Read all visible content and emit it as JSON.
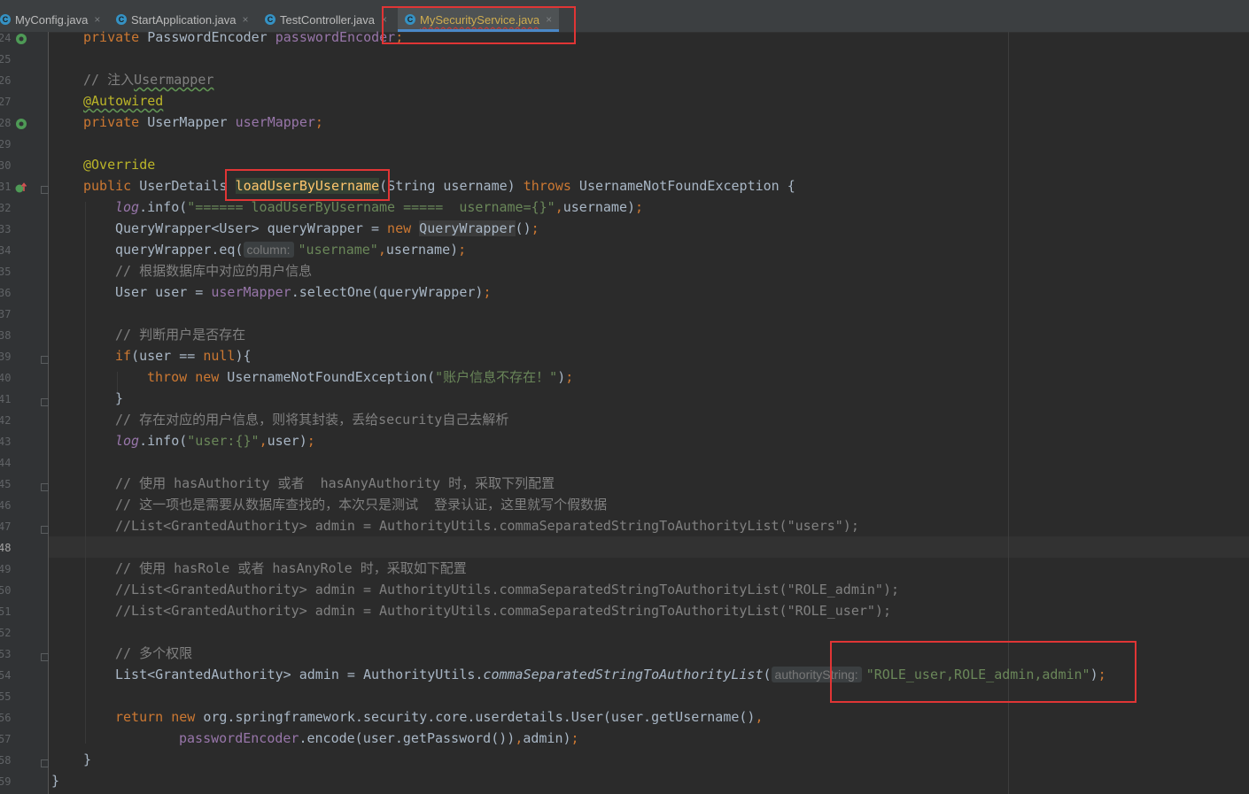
{
  "tabs": [
    {
      "label": "MyConfig.java",
      "icon": "class-icon",
      "close": "×"
    },
    {
      "label": "StartApplication.java",
      "icon": "class-icon",
      "close": "×"
    },
    {
      "label": "TestController.java",
      "icon": "class-icon",
      "close": "×"
    },
    {
      "label": "MySecurityService.java",
      "icon": "class-icon",
      "close": "×",
      "active": true
    }
  ],
  "tab_icon_glyph": "C",
  "gutter": {
    "line_numbers": [
      "24",
      "25",
      "26",
      "27",
      "28",
      "29",
      "30",
      "31",
      "32",
      "33",
      "34",
      "35",
      "36",
      "37",
      "38",
      "39",
      "40",
      "41",
      "42",
      "43",
      "44",
      "45",
      "46",
      "47",
      "48",
      "49",
      "50",
      "51",
      "52",
      "53",
      "54",
      "55",
      "56",
      "57",
      "58",
      "59"
    ],
    "current_line": "48",
    "icons": [
      "bean-icon",
      "bean-icon",
      "override-method-icon"
    ]
  },
  "code": {
    "field_pe_kw": "private",
    "field_pe_type": " PasswordEncoder ",
    "field_pe_name": "passwordEncoder",
    "field_pe_semi": ";",
    "comment_inject_prefix": "// 注入",
    "comment_inject_word": "Usermapper",
    "autowired": "@Autowired",
    "field_um_kw": "private",
    "field_um_type": " UserMapper ",
    "field_um_name": "userMapper",
    "field_um_semi": ";",
    "override": "@Override",
    "method_public": "public",
    "method_ret": " UserDetails ",
    "method_name": "loadUserByUsername",
    "method_params": "(String username) ",
    "method_throws": "throws",
    "method_exc": " UsernameNotFoundException {",
    "l32_log": "log",
    "l32_info": ".info(",
    "l32_str": "\"====== loadUserByUsername =====  username={}\"",
    "l32_comma": ",",
    "l32_rest": "username)",
    "l32_semi": ";",
    "l33_a": "QueryWrapper<User> queryWrapper = ",
    "l33_new": "new",
    "l33_sp": " ",
    "l33_cls": "QueryWrapper",
    "l33_b": "()",
    "l33_semi": ";",
    "l34_a": "queryWrapper.eq(",
    "l34_hint": "column:",
    "l34_str": "\"username\"",
    "l34_comma": ",",
    "l34_b": "username)",
    "l34_semi": ";",
    "l35_comment": "// 根据数据库中对应的用户信息",
    "l36_a": "User user = ",
    "l36_field": "userMapper",
    "l36_b": ".selectOne(queryWrapper)",
    "l36_semi": ";",
    "l38_comment": "// 判断用户是否存在",
    "l39_if": "if",
    "l39_a": "(user == ",
    "l39_null": "null",
    "l39_b": "){",
    "l40_throw": "throw",
    "l40_sp": " ",
    "l40_new": "new",
    "l40_a": " UsernameNotFoundException(",
    "l40_str": "\"账户信息不存在！\"",
    "l40_b": ")",
    "l40_semi": ";",
    "l41_brace": "}",
    "l42_comment": "// 存在对应的用户信息，则将其封装，丢给security自己去解析",
    "l43_log": "log",
    "l43_info": ".info(",
    "l43_str": "\"user:{}\"",
    "l43_comma": ",",
    "l43_b": "user)",
    "l43_semi": ";",
    "l45_comment": "// 使用 hasAuthority 或者  hasAnyAuthority 时，采取下列配置",
    "l46_comment": "// 这一项也是需要从数据库查找的，本次只是测试  登录认证，这里就写个假数据",
    "l47_comment": "//List<GrantedAuthority> admin = AuthorityUtils.commaSeparatedStringToAuthorityList(\"users\");",
    "l49_comment": "// 使用 hasRole 或者 hasAnyRole 时，采取如下配置",
    "l50_comment": "//List<GrantedAuthority> admin = AuthorityUtils.commaSeparatedStringToAuthorityList(\"ROLE_admin\");",
    "l51_comment": "//List<GrantedAuthority> admin = AuthorityUtils.commaSeparatedStringToAuthorityList(\"ROLE_user\");",
    "l53_comment": "// 多个权限",
    "l54_a": "List<GrantedAuthority> admin = AuthorityUtils.",
    "l54_static": "commaSeparatedStringToAuthorityList",
    "l54_paren": "(",
    "l54_hint": "authorityString:",
    "l54_str": "\"ROLE_user,ROLE_admin,admin\"",
    "l54_b": ")",
    "l54_semi": ";",
    "l56_return": "return",
    "l56_sp": " ",
    "l56_new": "new",
    "l56_a": " org.springframework.security.core.userdetails.User(user.getUsername()",
    "l56_comma": ",",
    "l57_field": "passwordEncoder",
    "l57_a": ".encode(user.getPassword())",
    "l57_comma": ",",
    "l57_b": "admin)",
    "l57_semi": ";",
    "l58_brace": "}",
    "l59_brace": "}"
  },
  "colors": {
    "background": "#2b2b2b",
    "keyword": "#cc7832",
    "string": "#6a8759",
    "comment": "#808080",
    "annotation": "#bbb529",
    "field": "#9876aa",
    "method_decl": "#ffc66d",
    "highlight_box": "#e03535"
  }
}
